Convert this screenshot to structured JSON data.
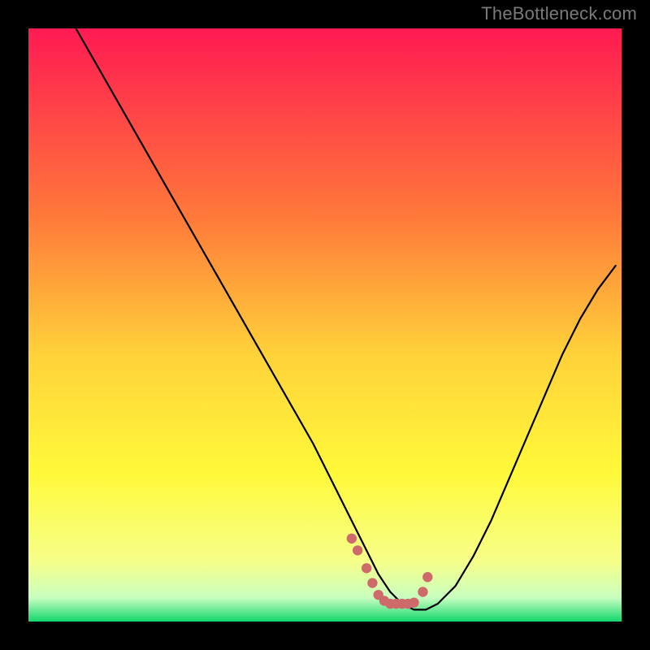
{
  "watermark": "TheBottleneck.com",
  "colors": {
    "frame_bg": "#000000",
    "curve": "#000000",
    "marker": "#cf6a6a",
    "gradient_top": "#ff1a52",
    "gradient_mid1": "#ff7a3a",
    "gradient_mid2": "#ffd23a",
    "gradient_mid3": "#fff93a",
    "gradient_mid4": "#f6ff8a",
    "gradient_bottom": "#12d66a"
  },
  "chart_data": {
    "type": "line",
    "title": "",
    "xlabel": "",
    "ylabel": "",
    "xlim": [
      0,
      100
    ],
    "ylim": [
      0,
      100
    ],
    "series": [
      {
        "name": "curve",
        "x": [
          8,
          12,
          16,
          20,
          24,
          28,
          32,
          36,
          40,
          44,
          48,
          51,
          54,
          57,
          59,
          61,
          63,
          65,
          67,
          69,
          72,
          75,
          78,
          81,
          84,
          87,
          90,
          93,
          96,
          99
        ],
        "y": [
          100,
          93,
          86,
          79,
          72,
          65,
          58,
          51,
          44,
          37,
          30,
          24,
          18,
          12,
          8,
          5,
          3,
          2,
          2,
          3,
          6,
          11,
          17,
          24,
          31,
          38,
          45,
          51,
          56,
          60
        ]
      }
    ],
    "markers": {
      "name": "highlight",
      "x": [
        54.5,
        55.5,
        57,
        58,
        59,
        60,
        61,
        62,
        63,
        64,
        65,
        66.5,
        67.3
      ],
      "y": [
        14,
        12,
        9,
        6.5,
        4.5,
        3.5,
        3,
        3,
        3,
        3,
        3.2,
        5,
        7.5
      ]
    }
  }
}
